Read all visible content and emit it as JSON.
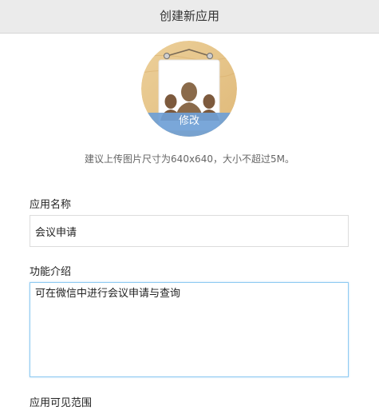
{
  "header": {
    "title": "创建新应用"
  },
  "avatar": {
    "edit_label": "修改",
    "icon": "group-people-icon"
  },
  "hint": {
    "text": "建议上传图片尺寸为640x640，大小不超过5M。"
  },
  "form": {
    "app_name": {
      "label": "应用名称",
      "value": "会议申请"
    },
    "description": {
      "label": "功能介绍",
      "value": "可在微信中进行会议申请与查询"
    },
    "visibility": {
      "label": "应用可见范围"
    }
  },
  "colors": {
    "header_bg": "#ebebeb",
    "focus_border": "#8fcbf2",
    "avatar_wood": "#e9c98f",
    "avatar_band": "#6f9fd6"
  }
}
